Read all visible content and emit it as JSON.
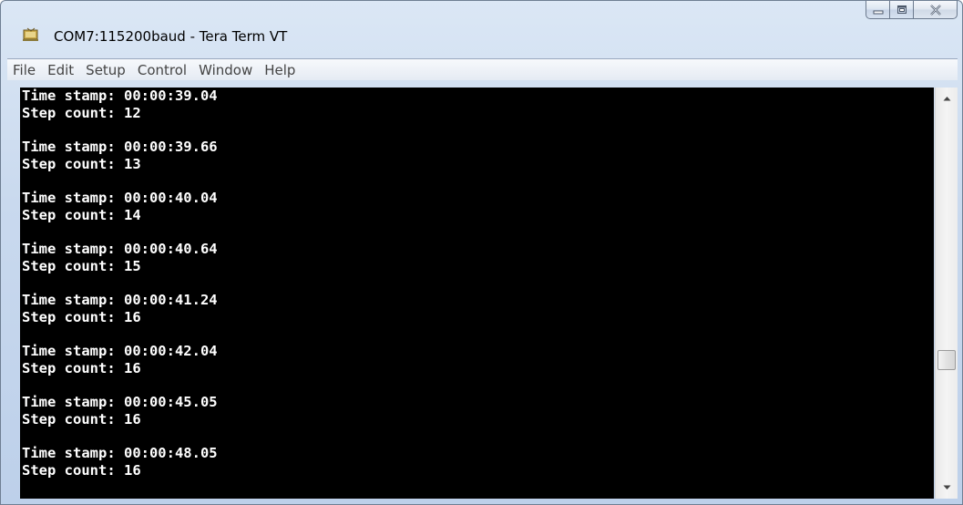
{
  "window": {
    "title": "COM7:115200baud - Tera Term VT",
    "app_icon": "tera-term-icon",
    "caption_buttons": {
      "minimize": "minimize-icon",
      "maximize": "maximize-icon",
      "close": "close-icon"
    }
  },
  "menu": {
    "items": [
      {
        "label": "File"
      },
      {
        "label": "Edit"
      },
      {
        "label": "Setup"
      },
      {
        "label": "Control"
      },
      {
        "label": "Window"
      },
      {
        "label": "Help"
      }
    ]
  },
  "terminal": {
    "background": "#000000",
    "foreground": "#ffffff",
    "records": [
      {
        "time_line": "Time stamp: 00:00:39.04",
        "step_line": "Step count: 12"
      },
      {
        "time_line": "Time stamp: 00:00:39.66",
        "step_line": "Step count: 13"
      },
      {
        "time_line": "Time stamp: 00:00:40.04",
        "step_line": "Step count: 14"
      },
      {
        "time_line": "Time stamp: 00:00:40.64",
        "step_line": "Step count: 15"
      },
      {
        "time_line": "Time stamp: 00:00:41.24",
        "step_line": "Step count: 16"
      },
      {
        "time_line": "Time stamp: 00:00:42.04",
        "step_line": "Step count: 16"
      },
      {
        "time_line": "Time stamp: 00:00:45.05",
        "step_line": "Step count: 16"
      },
      {
        "time_line": "Time stamp: 00:00:48.05",
        "step_line": "Step count: 16"
      }
    ]
  },
  "scrollbar": {
    "up_icon": "scroll-up-arrow-icon",
    "down_icon": "scroll-down-arrow-icon",
    "position_fraction": 0.69
  }
}
